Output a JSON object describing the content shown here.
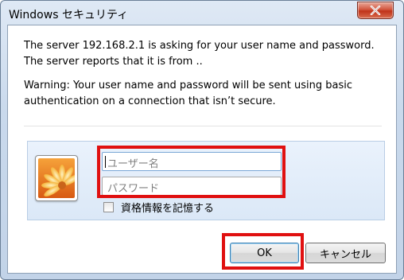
{
  "window": {
    "title": "Windows セキュリティ"
  },
  "message": {
    "line1": "The server 192.168.2.1 is asking for your user name and password. The server reports that it is from ..",
    "line2": "Warning: Your user name and password will be sent using basic authentication on a connection that isn’t secure."
  },
  "credentials": {
    "username_placeholder": "ユーザー名",
    "password_placeholder": "パスワード",
    "remember_label": "資格情報を記憶する",
    "remember_checked": false
  },
  "buttons": {
    "ok_label": "OK",
    "cancel_label": "キャンセル"
  },
  "icons": {
    "close": "close-icon",
    "user_tile": "flower-user-tile-icon"
  },
  "colors": {
    "highlight": "#e01010",
    "close_button": "#c03319",
    "panel": "#dbe8f7"
  }
}
